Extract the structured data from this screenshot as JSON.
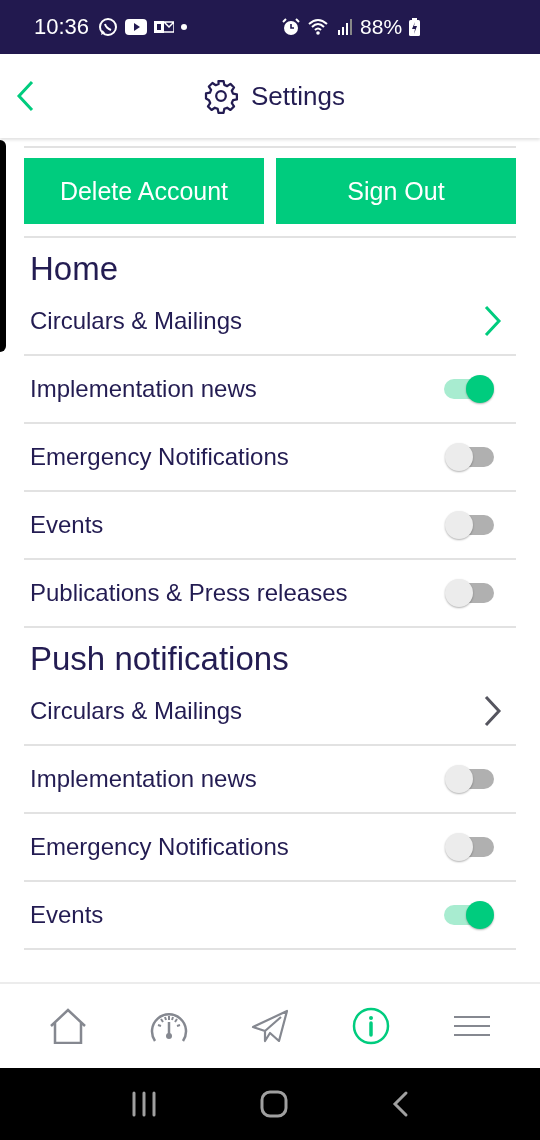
{
  "status_bar": {
    "time": "10:36",
    "battery": "88%"
  },
  "header": {
    "title": "Settings"
  },
  "buttons": [
    "Delete Account",
    "Sign Out"
  ],
  "sections": [
    {
      "title": "Home",
      "rows": [
        {
          "kind": "link",
          "label": "Circulars & Mailings",
          "selected": true
        },
        {
          "kind": "toggle",
          "label": "Implementation news",
          "on": true
        },
        {
          "kind": "toggle",
          "label": "Emergency Notifications",
          "on": false
        },
        {
          "kind": "toggle",
          "label": "Events",
          "on": false
        },
        {
          "kind": "toggle",
          "label": "Publications & Press releases",
          "on": false
        }
      ]
    },
    {
      "title": "Push notifications",
      "rows": [
        {
          "kind": "link",
          "label": "Circulars & Mailings",
          "selected": false
        },
        {
          "kind": "toggle",
          "label": "Implementation news",
          "on": false
        },
        {
          "kind": "toggle",
          "label": "Emergency Notifications",
          "on": false
        },
        {
          "kind": "toggle",
          "label": "Events",
          "on": true
        }
      ]
    }
  ],
  "nav": [
    {
      "kind": "home",
      "selected": false
    },
    {
      "kind": "gauge",
      "selected": false
    },
    {
      "kind": "send",
      "selected": false
    },
    {
      "kind": "info",
      "selected": true
    },
    {
      "kind": "menu",
      "selected": false
    }
  ]
}
